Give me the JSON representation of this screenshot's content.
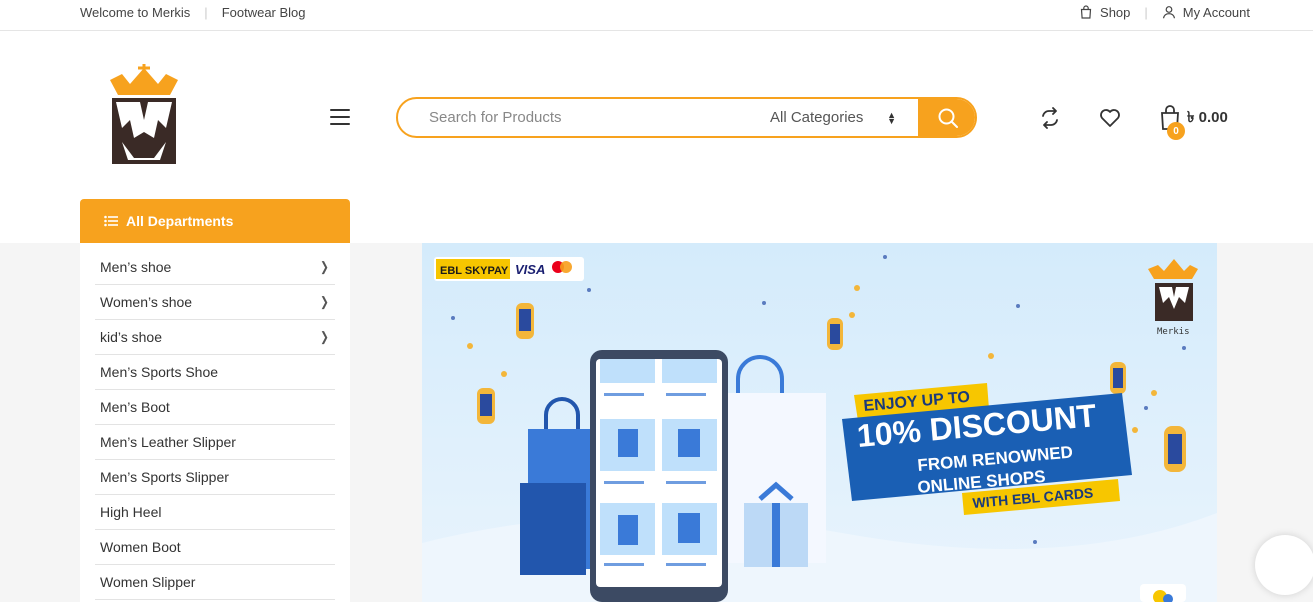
{
  "topbar": {
    "welcome": "Welcome to Merkis",
    "blog": "Footwear Blog",
    "shop": "Shop",
    "account": "My Account"
  },
  "search": {
    "placeholder": "Search for Products",
    "category": "All Categories"
  },
  "cart": {
    "count": "0",
    "amount": "৳ 0.00"
  },
  "departments": {
    "title": "All Departments",
    "items": [
      {
        "label": "Men’s shoe",
        "has_sub": true
      },
      {
        "label": "Women’s shoe",
        "has_sub": true
      },
      {
        "label": "kid’s shoe",
        "has_sub": true
      },
      {
        "label": "Men’s Sports Shoe",
        "has_sub": false
      },
      {
        "label": "Men’s Boot",
        "has_sub": false
      },
      {
        "label": "Men’s Leather Slipper",
        "has_sub": false
      },
      {
        "label": "Men’s Sports Slipper",
        "has_sub": false
      },
      {
        "label": "High Heel",
        "has_sub": false
      },
      {
        "label": "Women Boot",
        "has_sub": false
      },
      {
        "label": "Women Slipper",
        "has_sub": false
      }
    ]
  },
  "banner": {
    "partner": "EBL SKYPAY",
    "visa": "VISA",
    "brand": "Merkis",
    "line1": "ENJOY UP TO",
    "line2": "10% DISCOUNT",
    "line3": "FROM RENOWNED",
    "line4": "ONLINE SHOPS",
    "line5": "WITH EBL CARDS"
  },
  "colors": {
    "accent": "#f7a21e",
    "banner_bg": "#dcefff",
    "banner_blue": "#1a5fb4"
  }
}
